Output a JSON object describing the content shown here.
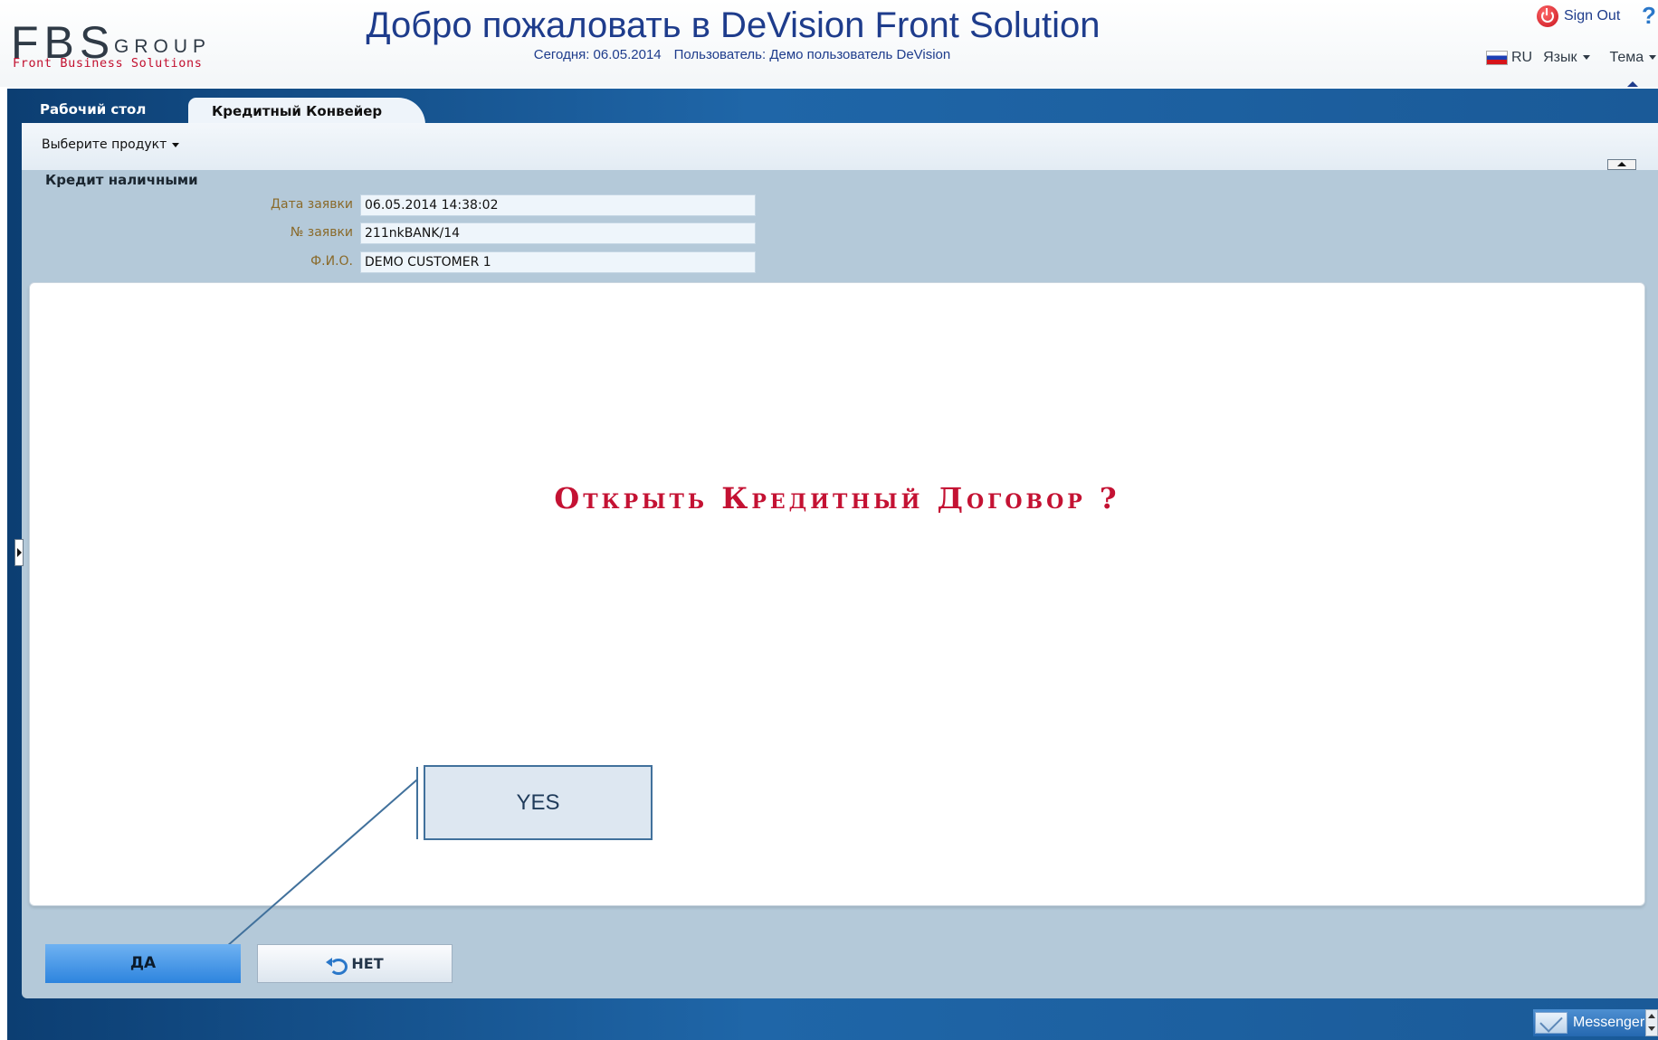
{
  "header": {
    "logo": {
      "main": "FBS",
      "group": "GROUP",
      "sub": "Front Business Solutions"
    },
    "welcome": "Добро пожаловать в DeVision Front Solution",
    "today": "Сегодня: 06.05.2014",
    "user": "Пользователь: Демо пользователь DeVision",
    "sign_out": "Sign Out",
    "lang_code": "RU",
    "lang_menu": "Язык",
    "theme_menu": "Тема"
  },
  "tabs": [
    {
      "label": "Рабочий стол",
      "active": false
    },
    {
      "label": "Кредитный Конвейер",
      "active": true
    }
  ],
  "toolbar": {
    "product_select": "Выберите продукт"
  },
  "form": {
    "title": "Кредит наличными",
    "fields": [
      {
        "label": "Дата заявки",
        "value": "06.05.2014 14:38:02"
      },
      {
        "label": "№ заявки",
        "value": "211nkBANK/14"
      },
      {
        "label": "Ф.И.О.",
        "value": "DEMO CUSTOMER 1"
      }
    ]
  },
  "dialog": {
    "question": "Открыть Кредитный Договор ?"
  },
  "buttons": {
    "yes": "ДА",
    "no": "НЕТ"
  },
  "annotation": {
    "callout": "YES"
  },
  "footer": {
    "messenger": "Messenger"
  },
  "colors": {
    "brand_blue": "#1e3c8c",
    "accent_red": "#c41233",
    "frame_blue": "#1f66a8",
    "yes_button": "#2d84de"
  }
}
